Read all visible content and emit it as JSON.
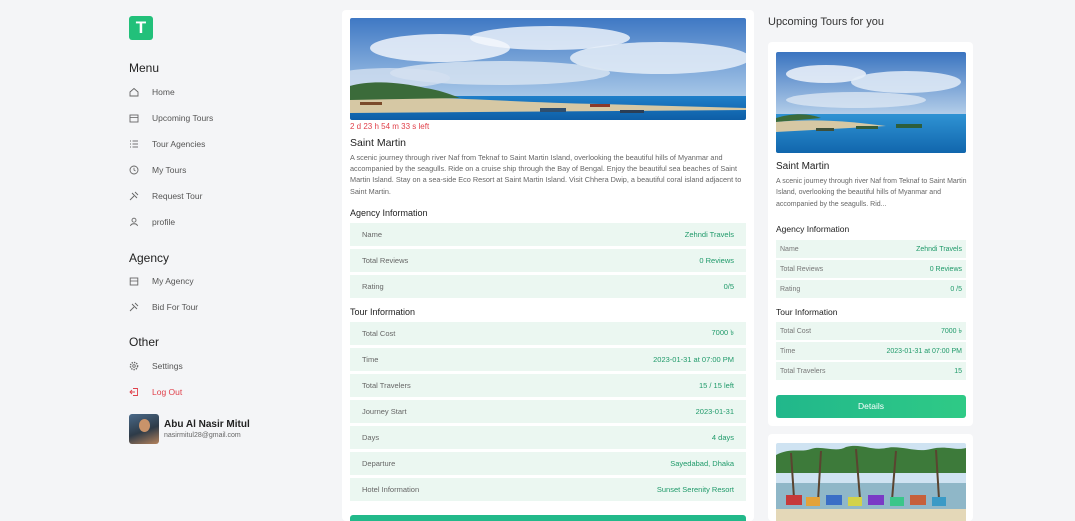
{
  "sidebar": {
    "logo_letter": "T",
    "menu_title": "Menu",
    "menu_items": [
      {
        "label": "Home",
        "icon": "home-icon"
      },
      {
        "label": "Upcoming Tours",
        "icon": "calendar-icon"
      },
      {
        "label": "Tour Agencies",
        "icon": "list-icon"
      },
      {
        "label": "My Tours",
        "icon": "clock-icon"
      },
      {
        "label": "Request Tour",
        "icon": "request-icon"
      },
      {
        "label": "profile",
        "icon": "user-icon"
      }
    ],
    "agency_title": "Agency",
    "agency_items": [
      {
        "label": "My Agency",
        "icon": "building-icon"
      },
      {
        "label": "Bid For Tour",
        "icon": "bid-icon"
      }
    ],
    "other_title": "Other",
    "other_items": [
      {
        "label": "Settings",
        "icon": "gear-icon"
      },
      {
        "label": "Log Out",
        "icon": "logout-icon"
      }
    ],
    "user": {
      "name": "Abu Al Nasir Mitul",
      "email": "nasirmitul28@gmail.com"
    }
  },
  "tour": {
    "countdown": "2 d 23 h 54 m 33 s left",
    "title": "Saint Martin",
    "description": "A scenic journey through river Naf from Teknaf to Saint Martin Island, overlooking the beautiful hills of Myanmar and accompanied by the seagulls. Ride on a cruise ship through the Bay of Bengal. Enjoy the beautiful sea beaches of Saint Martin Island. Stay on a sea-side Eco Resort at Saint Martin Island. Visit Chhera Dwip, a beautiful coral island adjacent to Saint Martin.",
    "agency_heading": "Agency Information",
    "agency_rows": [
      {
        "label": "Name",
        "value": "Zehndi Travels"
      },
      {
        "label": "Total Reviews",
        "value": "0 Reviews"
      },
      {
        "label": "Rating",
        "value": "0/5"
      }
    ],
    "tour_heading": "Tour Information",
    "tour_rows": [
      {
        "label": "Total Cost",
        "value": "7000 ৳"
      },
      {
        "label": "Time",
        "value": "2023-01-31 at 07:00 PM"
      },
      {
        "label": "Total Travelers",
        "value": "15 / 15 left"
      },
      {
        "label": "Journey Start",
        "value": "2023-01-31"
      },
      {
        "label": "Days",
        "value": "4 days"
      },
      {
        "label": "Departure",
        "value": "Sayedabad, Dhaka"
      },
      {
        "label": "Hotel Information",
        "value": "Sunset Serenity Resort"
      }
    ]
  },
  "upcoming": {
    "title": "Upcoming Tours for you",
    "card": {
      "title": "Saint Martin",
      "description": "A scenic journey through river Naf from Teknaf to Saint Martin Island, overlooking the beautiful hills of Myanmar and accompanied by the seagulls. Rid...",
      "agency_heading": "Agency Information",
      "agency_rows": [
        {
          "label": "Name",
          "value": "Zehndi Travels"
        },
        {
          "label": "Total Reviews",
          "value": "0 Reviews"
        },
        {
          "label": "Rating",
          "value": "0 /5"
        }
      ],
      "tour_heading": "Tour Information",
      "tour_rows": [
        {
          "label": "Total Cost",
          "value": "7000 ৳"
        },
        {
          "label": "Time",
          "value": "2023-01-31 at 07:00 PM"
        },
        {
          "label": "Total Travelers",
          "value": "15"
        }
      ],
      "details_label": "Details"
    }
  },
  "colors": {
    "accent": "#22c07a",
    "logout": "#e0404a",
    "row_bg": "#ebf7f1",
    "value_text": "#1f9a6a"
  }
}
